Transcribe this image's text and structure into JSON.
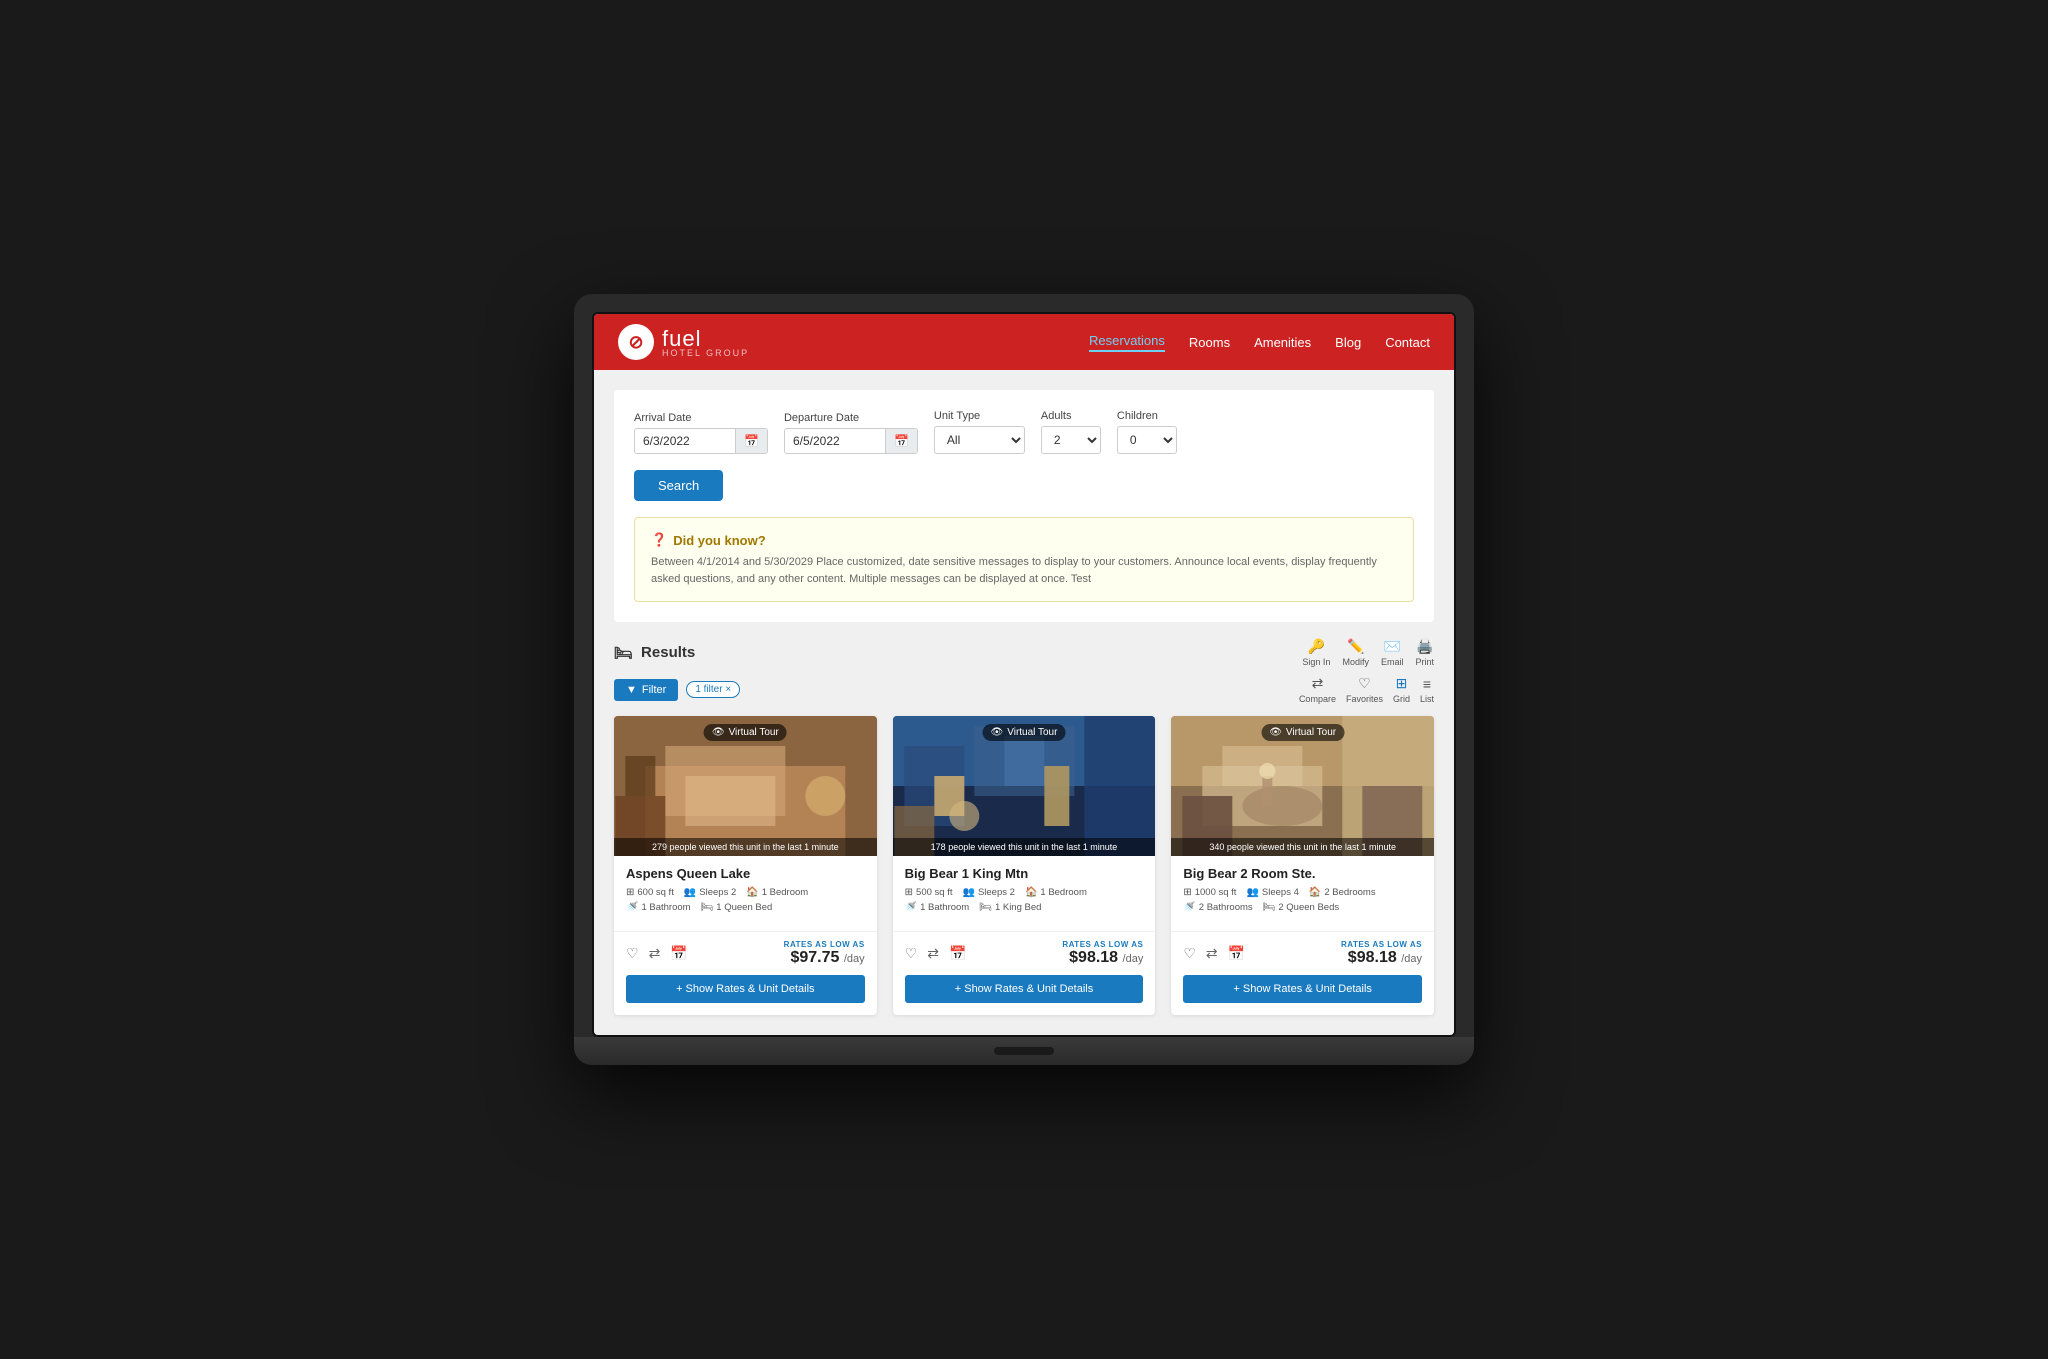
{
  "header": {
    "logo_text": "fuel",
    "logo_sub": "HOTEL GROUP",
    "logo_icon": "⊘",
    "nav": [
      {
        "label": "Reservations",
        "active": true
      },
      {
        "label": "Rooms",
        "active": false
      },
      {
        "label": "Amenities",
        "active": false
      },
      {
        "label": "Blog",
        "active": false
      },
      {
        "label": "Contact",
        "active": false
      }
    ]
  },
  "search": {
    "arrival_label": "Arrival Date",
    "arrival_value": "6/3/2022",
    "departure_label": "Departure Date",
    "departure_value": "6/5/2022",
    "unit_type_label": "Unit Type",
    "unit_type_value": "All",
    "adults_label": "Adults",
    "adults_value": "2",
    "children_label": "Children",
    "children_value": "0",
    "search_button": "Search"
  },
  "info_box": {
    "title": "Did you know?",
    "text": "Between 4/1/2014 and 5/30/2029 Place customized, date sensitive messages to display to your customers. Announce local events, display frequently asked questions, and any other content. Multiple messages can be displayed at once. Test"
  },
  "results": {
    "title": "Results",
    "actions": [
      {
        "label": "Sign In",
        "icon": "→□"
      },
      {
        "label": "Modify",
        "icon": "✎"
      },
      {
        "label": "Email",
        "icon": "✉"
      },
      {
        "label": "Print",
        "icon": "🖨"
      }
    ],
    "filter_label": "Filter",
    "filter_badge": "1 filter ×",
    "view_modes": [
      {
        "label": "Compare",
        "icon": "⇄"
      },
      {
        "label": "Favorites",
        "icon": "♡"
      },
      {
        "label": "Grid",
        "icon": "⊞",
        "active": true
      },
      {
        "label": "List",
        "icon": "≡"
      }
    ]
  },
  "cards": [
    {
      "id": "card-1",
      "virtual_tour": "Virtual Tour",
      "viewer_count": "279 people viewed this unit in the last 1 minute",
      "title": "Aspens Queen Lake",
      "sqft": "600 sq ft",
      "sleeps": "Sleeps 2",
      "bedrooms": "1 Bedroom",
      "bathrooms": "1 Bathroom",
      "bed_type": "1 Queen Bed",
      "rates_label": "RATES AS LOW AS",
      "price": "$97.75",
      "price_unit": "/day",
      "button": "+ Show Rates & Unit Details",
      "img_class": "img-cabin"
    },
    {
      "id": "card-2",
      "virtual_tour": "Virtual Tour",
      "viewer_count": "178 people viewed this unit in the last 1 minute",
      "title": "Big Bear 1 King Mtn",
      "sqft": "500 sq ft",
      "sleeps": "Sleeps 2",
      "bedrooms": "1 Bedroom",
      "bathrooms": "1 Bathroom",
      "bed_type": "1 King Bed",
      "rates_label": "RATES AS LOW AS",
      "price": "$98.18",
      "price_unit": "/day",
      "button": "+ Show Rates & Unit Details",
      "img_class": "img-city"
    },
    {
      "id": "card-3",
      "virtual_tour": "Virtual Tour",
      "viewer_count": "340 people viewed this unit in the last 1 minute",
      "title": "Big Bear 2 Room Ste.",
      "sqft": "1000 sq ft",
      "sleeps": "Sleeps 4",
      "bedrooms": "2 Bedrooms",
      "bathrooms": "2 Bathrooms",
      "bed_type": "2 Queen Beds",
      "rates_label": "RATES AS LOW AS",
      "price": "$98.18",
      "price_unit": "/day",
      "button": "+ Show Rates & Unit Details",
      "img_class": "img-hotel"
    }
  ],
  "colors": {
    "accent_red": "#cc2222",
    "accent_blue": "#1a7abf",
    "nav_active": "#6cd0f5"
  }
}
